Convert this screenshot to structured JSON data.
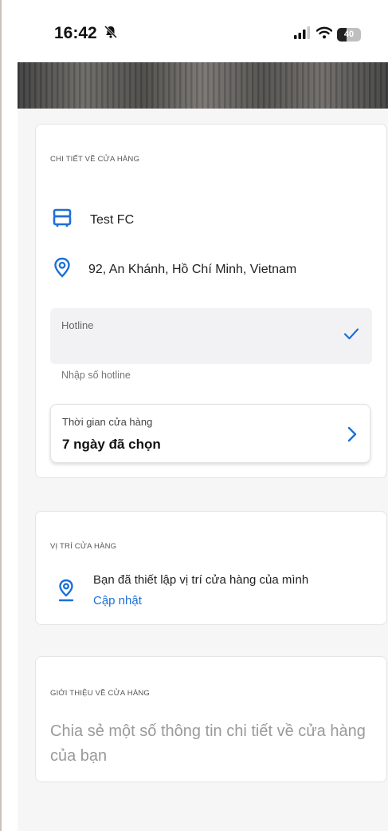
{
  "status_bar": {
    "time": "16:42",
    "battery": "40"
  },
  "store_details": {
    "section_title": "CHI TIẾT VỀ CỬA HÀNG",
    "store_name": "Test FC",
    "address": "92, An Khánh, Hồ Chí Minh, Vietnam",
    "hotline": {
      "label": "Hotline",
      "hint": "Nhập số hotline"
    },
    "store_hours": {
      "label": "Thời gian cửa hàng",
      "value": "7 ngày đã chọn"
    }
  },
  "store_location": {
    "section_title": "VỊ TRÍ CỬA HÀNG",
    "message": "Bạn đã thiết lập vị trí cửa hàng của mình",
    "update_link": "Cập nhật"
  },
  "store_about": {
    "section_title": "GIỚI THIỆU VỀ CỬA HÀNG",
    "placeholder": "Chia sẻ một số thông tin chi tiết về cửa hàng của bạn"
  },
  "colors": {
    "accent": "#1d6fd6",
    "background": "#f6f6f7"
  },
  "icons": [
    "bell-off-icon",
    "signal-icon",
    "wifi-icon",
    "battery-icon",
    "store-icon",
    "map-pin-icon",
    "checkmark-icon",
    "chevron-right-icon",
    "location-pin-icon"
  ]
}
